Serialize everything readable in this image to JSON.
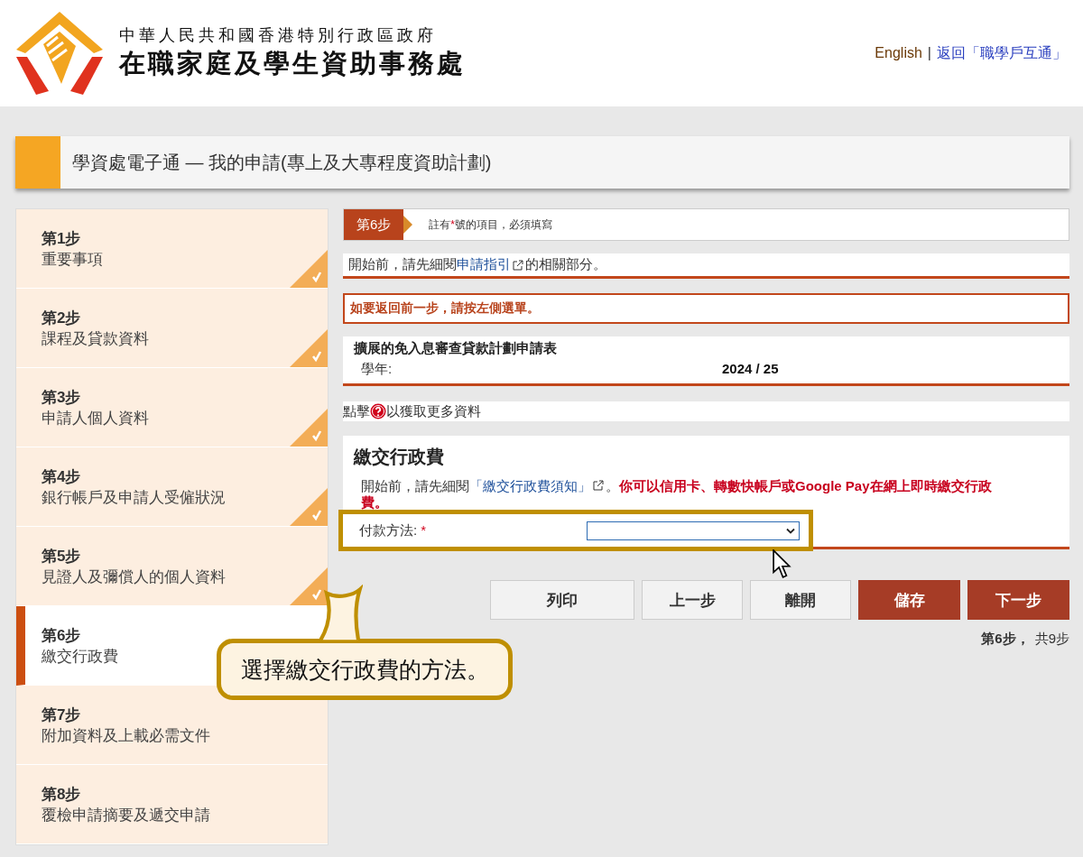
{
  "header": {
    "gov_name": "中華人民共和國香港特別行政區政府",
    "dept_name": "在職家庭及學生資助事務處",
    "links": [
      {
        "label": "English"
      },
      {
        "label": "返回「職學戶互通」"
      }
    ],
    "separator": "|"
  },
  "page_title": "學資處電子通 — 我的申請(專上及大專程度資助計劃)",
  "steps": [
    {
      "number": "第1步",
      "label": "重要事項",
      "completed": true,
      "selected": false
    },
    {
      "number": "第2步",
      "label": "課程及貸款資料",
      "completed": true,
      "selected": false
    },
    {
      "number": "第3步",
      "label": "申請人個人資料",
      "completed": true,
      "selected": false
    },
    {
      "number": "第4步",
      "label": "銀行帳戶及申請人受僱狀況",
      "completed": true,
      "selected": false
    },
    {
      "number": "第5步",
      "label": "見證人及彌償人的個人資料",
      "completed": true,
      "selected": false
    },
    {
      "number": "第6步",
      "label": "繳交行政費",
      "completed": false,
      "selected": true
    },
    {
      "number": "第7步",
      "label": "附加資料及上載必需文件",
      "completed": false,
      "selected": false
    },
    {
      "number": "第8步",
      "label": "覆檢申請摘要及遞交申請",
      "completed": false,
      "selected": false
    }
  ],
  "step_banner": {
    "badge": "第6步",
    "note_before": "註有",
    "note_mark": "*",
    "note_after": "號的項目，必須填寫"
  },
  "guide": {
    "before": "開始前，請先細閱",
    "link": "申請指引",
    "after": "的相關部分。"
  },
  "warning": "如要返回前一步，請按左側選單。",
  "form_info": {
    "title": "擴展的免入息審查貸款計劃申請表",
    "fields": [
      {
        "label": "學年:",
        "value": "2024 / 25"
      }
    ]
  },
  "help": {
    "before": "點擊",
    "after": "以獲取更多資料"
  },
  "section": {
    "title": "繳交行政費",
    "intro_before": "開始前，請先細閱",
    "link": "「繳交行政費須知」",
    "intro_after": "。",
    "notice": "你可以信用卡、轉數快帳戶或Google Pay在網上即時繳交行政費。"
  },
  "payment_field": {
    "label": "付款方法:",
    "required": "*",
    "highlighted": true
  },
  "buttons": [
    {
      "label": "列印",
      "kind": "secondary"
    },
    {
      "label": "上一步",
      "kind": "secondary"
    },
    {
      "label": "離開",
      "kind": "secondary"
    },
    {
      "label": "儲存",
      "kind": "primary"
    },
    {
      "label": "下一步",
      "kind": "primary"
    }
  ],
  "pager": {
    "current": "第6步，",
    "total": "共9步"
  },
  "callout": {
    "text": "選擇繳交行政費的方法。"
  }
}
